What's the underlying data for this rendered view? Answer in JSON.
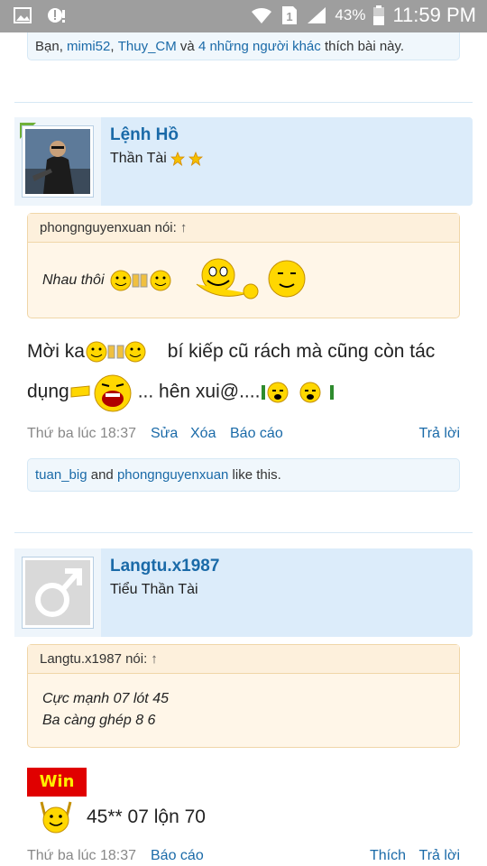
{
  "status_bar": {
    "battery_pct": "43%",
    "time": "11:59 PM",
    "sim_label": "1",
    "icons": [
      "image-icon",
      "alert-icon",
      "wifi-icon",
      "sim-icon",
      "signal-icon",
      "battery-icon"
    ]
  },
  "prev_post": {
    "likes": {
      "prefix": "Bạn, ",
      "user1": "mimi52",
      "sep": ", ",
      "user2": "Thuy_CM",
      "and": " và ",
      "others": "4 những người khác",
      "suffix": " thích bài này."
    }
  },
  "post1": {
    "author": "Lệnh Hồ",
    "title": "Thần Tài",
    "quote": {
      "header": "phongnguyenxuan nói:",
      "arrow": "↑",
      "body": "Nhau thôi"
    },
    "message": {
      "part1": "Mời ka",
      "part2": " bí kiếp cũ rách mà cũng còn tác dụng",
      "part3": "... hên xui@...."
    },
    "time": "Thứ ba lúc 18:37",
    "actions": {
      "edit": "Sửa",
      "delete": "Xóa",
      "report": "Báo cáo",
      "reply": "Trả lời"
    },
    "likes": {
      "user1": "tuan_big",
      "and": " and ",
      "user2": "phongnguyenxuan",
      "suffix": " like this."
    }
  },
  "post2": {
    "author": "Langtu.x1987",
    "title": "Tiểu Thần Tài",
    "quote": {
      "header": "Langtu.x1987 nói:",
      "arrow": "↑",
      "line1": "Cực mạnh 07 lót 45",
      "line2": "Ba càng ghép 8 6"
    },
    "win_label": "Win",
    "message": "45** 07 lộn 70",
    "time": "Thứ ba lúc 18:37",
    "actions": {
      "report": "Báo cáo",
      "like": "Thích",
      "reply": "Trả lời"
    }
  },
  "colors": {
    "link": "#1a6aa8",
    "post_header_bg": "#dcecfa",
    "quote_bg": "#fff6e8",
    "status_bar": "#9e9e9e"
  }
}
